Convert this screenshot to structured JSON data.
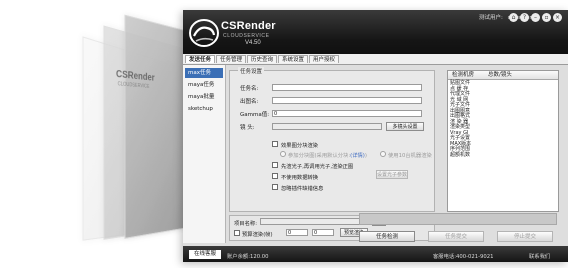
{
  "app": {
    "brand": "CSRender",
    "subtitle": "CLOUDSERVICE",
    "version": "V4.50",
    "user_label": "测试用户:",
    "user_name": "csrender"
  },
  "window_buttons": [
    "home-icon",
    "question-icon",
    "minimize-icon",
    "restore-icon",
    "close-icon"
  ],
  "menu_tabs": [
    {
      "label": "发送任务",
      "active": true
    },
    {
      "label": "任务管理",
      "active": false
    },
    {
      "label": "历史查询",
      "active": false
    },
    {
      "label": "系统设置",
      "active": false
    },
    {
      "label": "用户授权",
      "active": false
    }
  ],
  "sidebar": {
    "items": [
      {
        "label": "max任务",
        "active": true
      },
      {
        "label": "maya任务",
        "active": false
      },
      {
        "label": "maya批量",
        "active": false
      },
      {
        "label": "sketchup",
        "active": false
      }
    ]
  },
  "settings": {
    "group_title": "任务设置",
    "task_name_label": "任务名:",
    "out_name_label": "出图名:",
    "gamma_label": "Gamma值:",
    "gamma_value": "0",
    "camera_label": "镜    头:",
    "multi_camera_button": "多镜头设置",
    "options": {
      "preview": "效果图分块渲染",
      "split_hint_prefix": "参加分块图(采用默认分块:",
      "split_hint_link": "(详情)",
      "split_hint_suffix": ")",
      "use_server": "使用10台机器渲染",
      "photon": "先渲光子,再调用光子,渲染正图",
      "photon_settings": "设置光子参数",
      "no_vray_param": "不使用数据转换",
      "ignore_missing": "忽略插件缺错信息"
    }
  },
  "camera_list": {
    "col_camera": "检测机房",
    "col_sep": "",
    "col_total": "总数/镜头",
    "items": [
      "贴图文件",
      "点 缓 存",
      "代理文件",
      "光 域 网",
      "光子文件",
      "出图图意",
      "出图格式",
      "渲 染 器",
      "渲染类型",
      "Vray GI",
      "光子设置",
      "MAX版本",
      "序列范围",
      "超额机数"
    ]
  },
  "project": {
    "name_label": "项目名称:",
    "refresh_button": "刷新",
    "check_all_label": "预算渲染(帧)",
    "from_value": "0",
    "to_value": "0",
    "preview_button": "预览渲染"
  },
  "actions": {
    "check_button": "任务检测",
    "submit_button": "任务提交",
    "stop_button": "停止提交"
  },
  "statusbar": {
    "online_tab": "在线客服",
    "balance": "账户余额:120.00",
    "phone": "客服电话:400-021-9021",
    "contact": "联系我们"
  }
}
